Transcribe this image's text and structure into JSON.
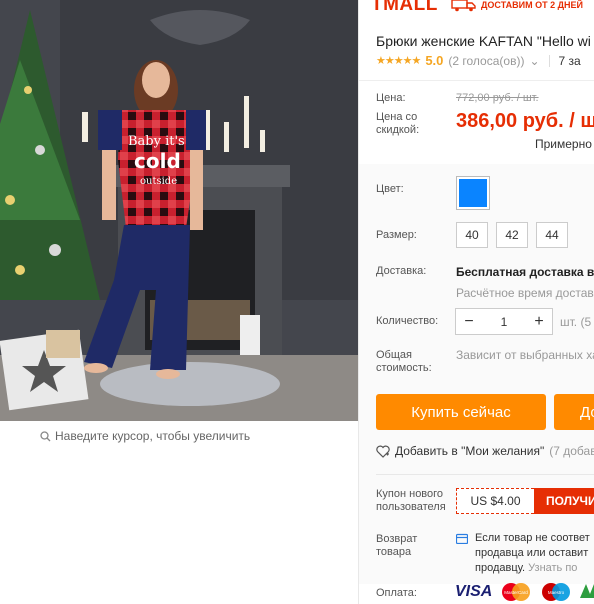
{
  "zoom_hint": "Наведите курсор, чтобы увеличить",
  "brand": {
    "logo": "TMALL",
    "shipping_banner": "ДОСТАВИМ ОТ 2 ДНЕЙ"
  },
  "product": {
    "title": "Брюки женские KAFTAN \"Hello wi",
    "rating": "5.0",
    "votes": "(2 голоса(ов))",
    "orders": "7 за"
  },
  "price": {
    "label_price": "Цена:",
    "old": "772,00 руб. / шт.",
    "label_discount": "Цена со скидкой:",
    "new": "386,00 руб. / шт",
    "approx": "Примерно"
  },
  "options": {
    "color_label": "Цвет:",
    "color_hex": "#0a84ff",
    "size_label": "Размер:",
    "sizes": [
      "40",
      "42",
      "44"
    ],
    "delivery_label": "Доставка:",
    "delivery_value": "Бесплатная доставка в Р",
    "delivery_time": "Расчётное время доставк",
    "qty_label": "Количество:",
    "qty_value": "1",
    "qty_unit": "шт. (5 н",
    "total_label": "Общая стоимость:",
    "total_value": "Зависит от выбранных ха"
  },
  "actions": {
    "buy_now": "Купить сейчас",
    "add_to_cart": "До",
    "wishlist": "Добавить в \"Мои желания\"",
    "wishlist_count": "(7 добав"
  },
  "coupon": {
    "label": "Купон нового пользователя",
    "amount": "US $4.00",
    "get": "ПОЛУЧИ"
  },
  "return": {
    "label": "Возврат товара",
    "line1": "Если товар не соответ",
    "line2": "продавца или оставит",
    "line3": "продавцу.",
    "link": "Узнать по"
  },
  "payment": {
    "label": "Оплата:",
    "visa": "VISA",
    "mastercard": "MasterCard",
    "maestro": "Maestro"
  },
  "colors": {
    "accent": "#e62e04",
    "button": "#ff8a00",
    "star": "#f5a623"
  }
}
